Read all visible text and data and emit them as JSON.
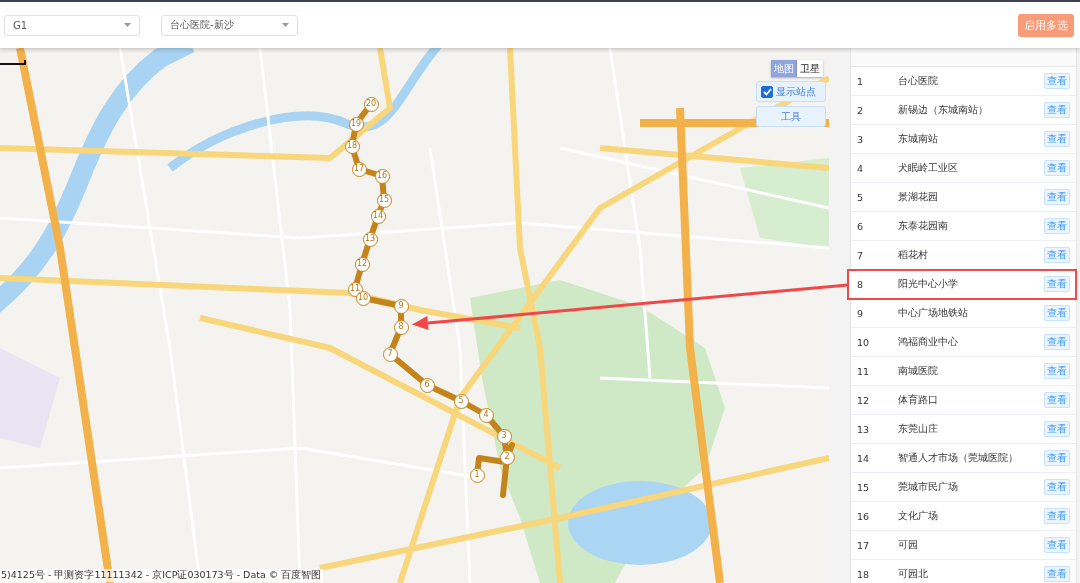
{
  "toolbar": {
    "route_select": {
      "value": "G1"
    },
    "direction_select": {
      "value": "台心医院-新沙"
    },
    "multi_select_button": "启用多选"
  },
  "map": {
    "map_type_tabs": [
      {
        "label": "地图",
        "selected": true
      },
      {
        "label": "卫星",
        "selected": false
      }
    ],
    "show_stops": {
      "label": "显示站点",
      "checked": true
    },
    "tools_button": "工具",
    "stops": [
      {
        "label": "20"
      },
      {
        "label": "19"
      },
      {
        "label": "18"
      },
      {
        "label": "17"
      },
      {
        "label": "16"
      },
      {
        "label": "15"
      },
      {
        "label": "14"
      },
      {
        "label": "13"
      },
      {
        "label": "12"
      },
      {
        "label": "11"
      },
      {
        "label": "10"
      },
      {
        "label": "9"
      },
      {
        "label": "8"
      },
      {
        "label": "7"
      },
      {
        "label": "6"
      },
      {
        "label": "5"
      },
      {
        "label": "4"
      },
      {
        "label": "3"
      },
      {
        "label": "2"
      },
      {
        "label": "1"
      }
    ],
    "copyright": "5)4125号 - 甲测资字11111342 - 京ICP证030173号 - Data © 百度智图"
  },
  "stations": {
    "rows": [
      {
        "index": "1",
        "name": "台心医院",
        "action": "查看",
        "highlighted": false
      },
      {
        "index": "2",
        "name": "新锡边（东城南站）",
        "action": "查看",
        "highlighted": false
      },
      {
        "index": "3",
        "name": "东城南站",
        "action": "查看",
        "highlighted": false
      },
      {
        "index": "4",
        "name": "犬眠岭工业区",
        "action": "查看",
        "highlighted": false
      },
      {
        "index": "5",
        "name": "景湖花园",
        "action": "查看",
        "highlighted": false
      },
      {
        "index": "6",
        "name": "东泰花园南",
        "action": "查看",
        "highlighted": false
      },
      {
        "index": "7",
        "name": "稻花村",
        "action": "查看",
        "highlighted": false
      },
      {
        "index": "8",
        "name": "阳光中心小学",
        "action": "查看",
        "highlighted": true
      },
      {
        "index": "9",
        "name": "中心广场地铁站",
        "action": "查看",
        "highlighted": false
      },
      {
        "index": "10",
        "name": "鸿福商业中心",
        "action": "查看",
        "highlighted": false
      },
      {
        "index": "11",
        "name": "南城医院",
        "action": "查看",
        "highlighted": false
      },
      {
        "index": "12",
        "name": "体育路口",
        "action": "查看",
        "highlighted": false
      },
      {
        "index": "13",
        "name": "东莞山庄",
        "action": "查看",
        "highlighted": false
      },
      {
        "index": "14",
        "name": "智通人才市场（莞城医院）",
        "action": "查看",
        "highlighted": false
      },
      {
        "index": "15",
        "name": "莞城市民广场",
        "action": "查看",
        "highlighted": false
      },
      {
        "index": "16",
        "name": "文化广场",
        "action": "查看",
        "highlighted": false
      },
      {
        "index": "17",
        "name": "可园",
        "action": "查看",
        "highlighted": false
      },
      {
        "index": "18",
        "name": "可园北",
        "action": "查看",
        "highlighted": false
      }
    ]
  }
}
